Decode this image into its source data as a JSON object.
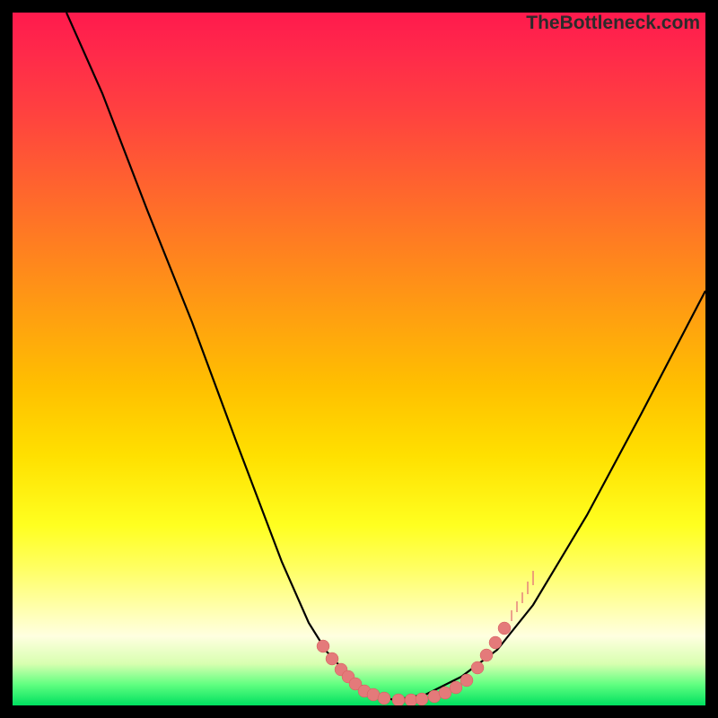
{
  "watermark": "TheBottleneck.com",
  "chart_data": {
    "type": "line",
    "title": "",
    "xlabel": "",
    "ylabel": "",
    "xlim": [
      0,
      772
    ],
    "ylim": [
      0,
      772
    ],
    "grid": false,
    "series": [
      {
        "name": "curve-left",
        "x": [
          60,
          100,
          150,
          200,
          250,
          300,
          330,
          350,
          380,
          405,
          425
        ],
        "y": [
          0,
          90,
          220,
          345,
          480,
          612,
          680,
          712,
          745,
          760,
          766
        ]
      },
      {
        "name": "curve-right",
        "x": [
          425,
          460,
          500,
          540,
          580,
          640,
          700,
          772
        ],
        "y": [
          766,
          760,
          740,
          710,
          660,
          560,
          448,
          310
        ]
      }
    ],
    "markers_left": [
      {
        "x": 346,
        "y": 706
      },
      {
        "x": 356,
        "y": 720
      },
      {
        "x": 366,
        "y": 732
      },
      {
        "x": 374,
        "y": 740
      },
      {
        "x": 382,
        "y": 748
      },
      {
        "x": 392,
        "y": 756
      },
      {
        "x": 402,
        "y": 760
      },
      {
        "x": 414,
        "y": 764
      }
    ],
    "markers_bottom": [
      {
        "x": 430,
        "y": 766
      },
      {
        "x": 444,
        "y": 766
      },
      {
        "x": 456,
        "y": 765
      },
      {
        "x": 470,
        "y": 762
      },
      {
        "x": 482,
        "y": 758
      },
      {
        "x": 494,
        "y": 752
      }
    ],
    "markers_right": [
      {
        "x": 506,
        "y": 744
      },
      {
        "x": 518,
        "y": 730
      },
      {
        "x": 528,
        "y": 716
      },
      {
        "x": 538,
        "y": 702
      },
      {
        "x": 548,
        "y": 686
      }
    ],
    "ticks_right": [
      {
        "x": 556,
        "y1": 666,
        "y2": 678
      },
      {
        "x": 562,
        "y1": 656,
        "y2": 668
      },
      {
        "x": 568,
        "y1": 646,
        "y2": 658
      },
      {
        "x": 574,
        "y1": 634,
        "y2": 648
      },
      {
        "x": 580,
        "y1": 622,
        "y2": 638
      }
    ]
  }
}
